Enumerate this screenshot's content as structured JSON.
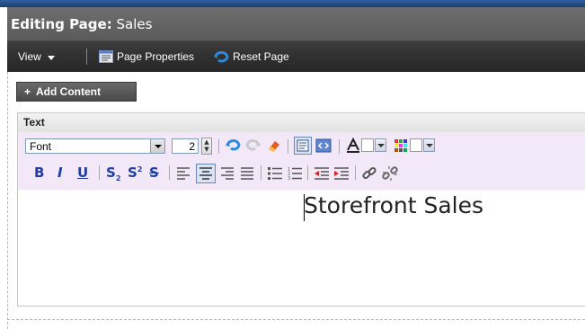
{
  "header": {
    "title_prefix": "Editing Page:",
    "title_page": "Sales"
  },
  "toolbar": {
    "view_label": "View",
    "page_properties_label": "Page Properties",
    "reset_page_label": "Reset Page"
  },
  "add_content": {
    "label": "Add Content",
    "icon": "plus-icon"
  },
  "panel": {
    "title": "Text"
  },
  "rte": {
    "font_value": "Font",
    "size_value": "2",
    "content_text": "Storefront Sales",
    "active_alignment": "center",
    "colors": {
      "toolbar_bg": "#f3e8f7",
      "format_icons": "#1f3da8",
      "header_bar": "#5f5f5f",
      "toolbar_bar": "#2f2f2f"
    }
  }
}
